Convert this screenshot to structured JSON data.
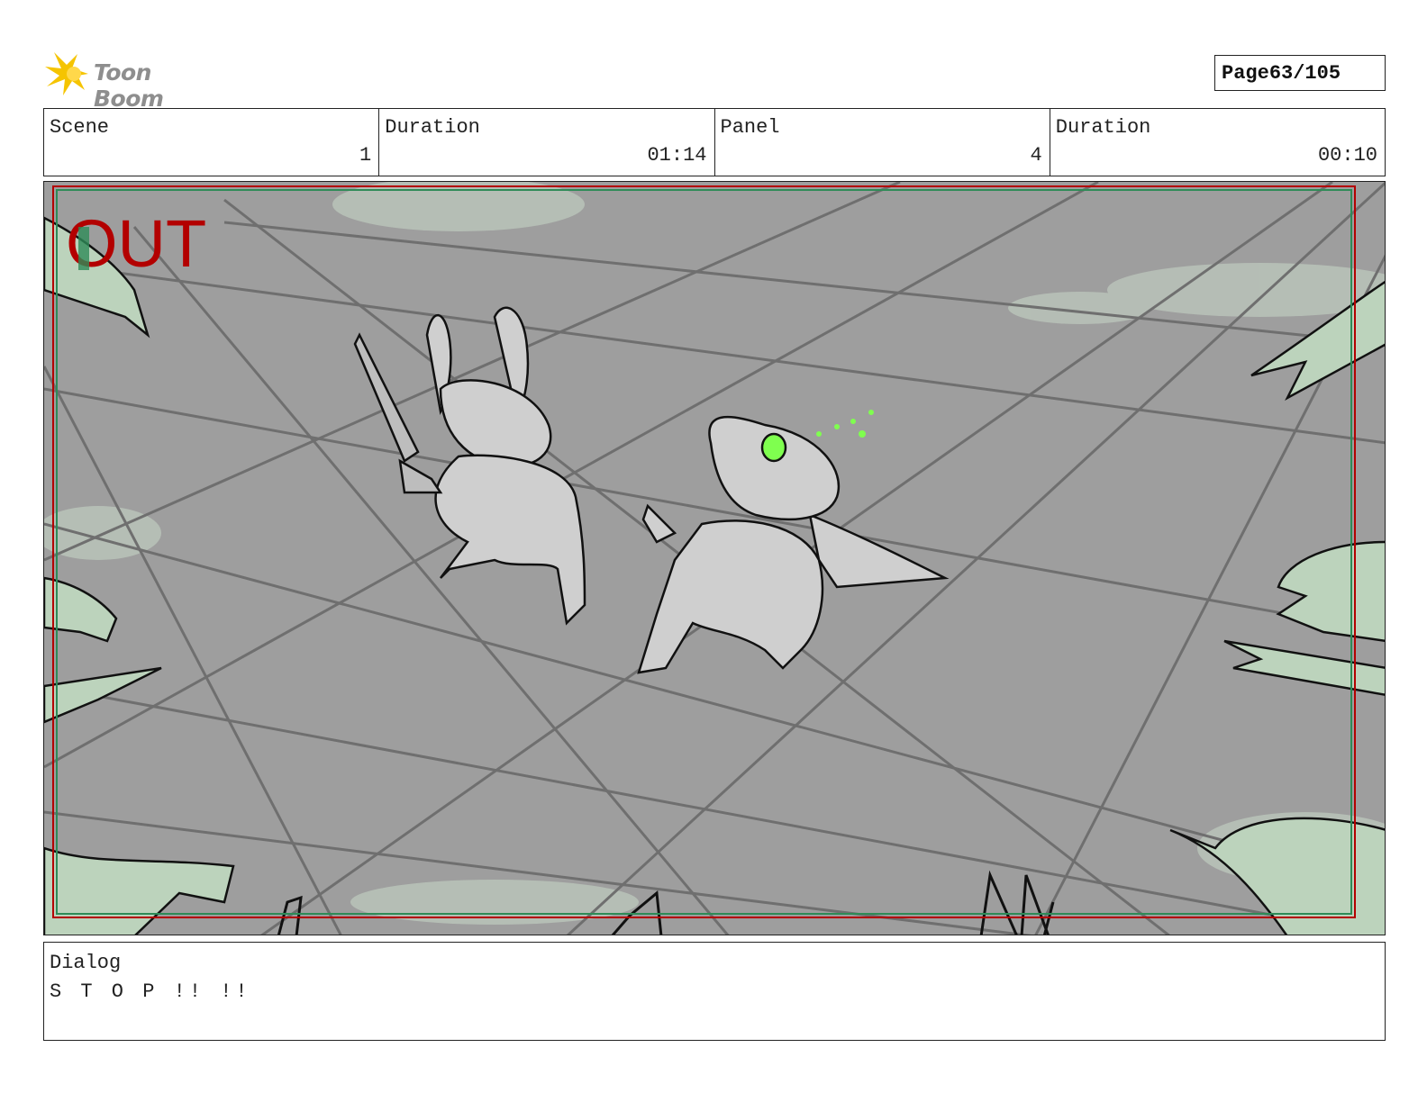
{
  "header": {
    "logo_text": "Toon Boom",
    "page_label": "Page",
    "page_value": "63/105"
  },
  "info": {
    "scene_label": "Scene",
    "scene_value": "1",
    "duration1_label": "Duration",
    "duration1_value": "01:14",
    "panel_label": "Panel",
    "panel_value": "4",
    "duration2_label": "Duration",
    "duration2_value": "00:10"
  },
  "panel_image": {
    "overlay_text": "OUT",
    "overlay_color": "#b30000",
    "accent_green": "#7fff4f",
    "safe_frame_colors": [
      "#b30000",
      "#2e8b57"
    ]
  },
  "dialog": {
    "label": "Dialog",
    "text": "S T O P !! !!"
  }
}
